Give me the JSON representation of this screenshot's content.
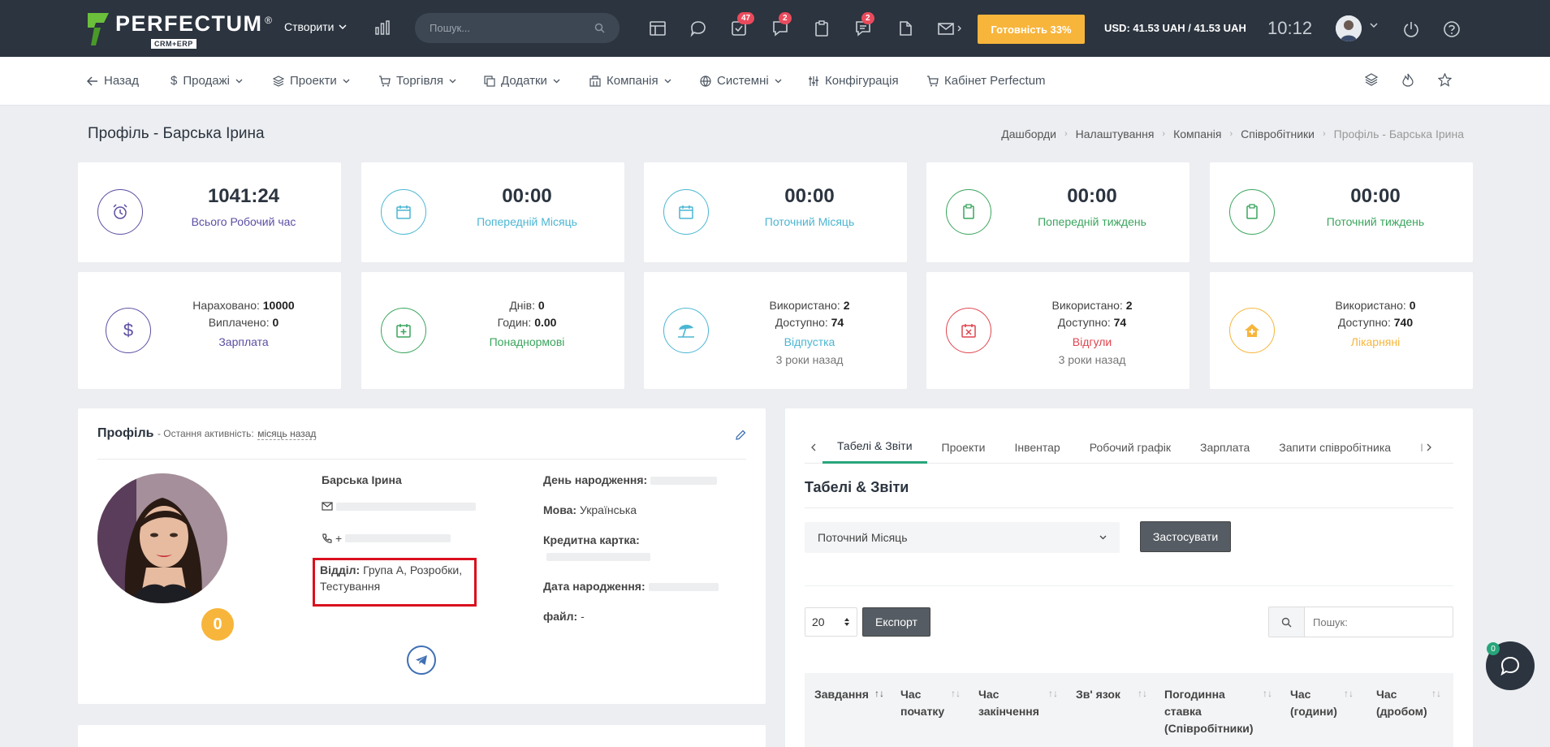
{
  "header": {
    "logo_name": "PERFECTUM",
    "logo_reg": "®",
    "logo_sub": "CRM+ERP",
    "create_label": "Створити",
    "search_placeholder": "Пошук...",
    "badges": {
      "tasks": "47",
      "chat": "2",
      "messages": "2"
    },
    "ready_label": "Готовність 33%",
    "currency": "USD: 41.53 UAH / 41.53 UAH",
    "time": "10:12"
  },
  "nav": {
    "back": "Назад",
    "items": [
      "Продажі",
      "Проекти",
      "Торгівля",
      "Додатки",
      "Компанія",
      "Системні",
      "Конфігурація",
      "Кабінет Perfectum"
    ]
  },
  "page": {
    "title": "Профіль - Барська Ірина",
    "breadcrumbs": [
      "Дашборди",
      "Налаштування",
      "Компанія",
      "Співробітники",
      "Профіль - Барська Ірина"
    ]
  },
  "stats_top": [
    {
      "value": "1041:24",
      "label": "Всього Робочий час",
      "color": "#5b4fa3",
      "icon": "alarm-clock-icon"
    },
    {
      "value": "00:00",
      "label": "Попередній Місяць",
      "color": "#4bb6d3",
      "icon": "calendar-icon"
    },
    {
      "value": "00:00",
      "label": "Поточний Місяць",
      "color": "#4bb6d3",
      "icon": "calendar-icon"
    },
    {
      "value": "00:00",
      "label": "Попередній тиждень",
      "color": "#3aa55d",
      "icon": "clipboard-icon"
    },
    {
      "value": "00:00",
      "label": "Поточний тиждень",
      "color": "#3aa55d",
      "icon": "clipboard-icon"
    }
  ],
  "stats_bottom": [
    {
      "l1": "Нараховано:",
      "v1": "10000",
      "l2": "Виплачено:",
      "v2": "0",
      "label": "Зарплата",
      "sub": "",
      "color": "#5b4fa3",
      "icon": "dollar-icon"
    },
    {
      "l1": "Днів:",
      "v1": "0",
      "l2": "Годин:",
      "v2": "0.00",
      "label": "Понаднормові",
      "sub": "",
      "color": "#3aa55d",
      "icon": "calendar-plus-icon"
    },
    {
      "l1": "Використано:",
      "v1": "2",
      "l2": "Доступно:",
      "v2": "74",
      "label": "Відпустка",
      "sub": "3 роки назад",
      "color": "#4bb6d3",
      "icon": "beach-umbrella-icon"
    },
    {
      "l1": "Використано:",
      "v1": "2",
      "l2": "Доступно:",
      "v2": "74",
      "label": "Відгули",
      "sub": "3 роки назад",
      "color": "#e0454f",
      "icon": "calendar-x-icon"
    },
    {
      "l1": "Використано:",
      "v1": "0",
      "l2": "Доступно:",
      "v2": "740",
      "label": "Лікарняні",
      "sub": "",
      "color": "#f7b53b",
      "icon": "home-medical-icon"
    }
  ],
  "profile": {
    "heading": "Профіль",
    "activity_label": "- Остання активність:",
    "activity_value": "місяць назад",
    "name": "Барська Ірина",
    "phone_prefix": "+",
    "department_label": "Відділ:",
    "department_value": "Група А, Розробки, Тестування",
    "birthday_label": "День народження:",
    "language_label": "Мова:",
    "language_value": "Українська",
    "card_label": "Кредитна картка:",
    "birthdate_label": "Дата народження:",
    "file_label": "файл:",
    "file_value": "-",
    "score": "0"
  },
  "tabs": {
    "items": [
      "Табелі & Звіти",
      "Проекти",
      "Інвентар",
      "Робочий графік",
      "Зарплата",
      "Запити співробітника",
      "І"
    ],
    "section_title": "Табелі & Звіти",
    "period": "Поточний Місяць",
    "apply": "Застосувати",
    "page_size": "20",
    "export": "Експорт",
    "search_placeholder": "Пошук:",
    "columns": [
      "Завдання",
      "Час початку",
      "Час закінчення",
      "Зв' язок",
      "Погодинна ставка (Співробітники)",
      "Час (години)",
      "Час (дробом)"
    ]
  },
  "chat_badge": "0"
}
